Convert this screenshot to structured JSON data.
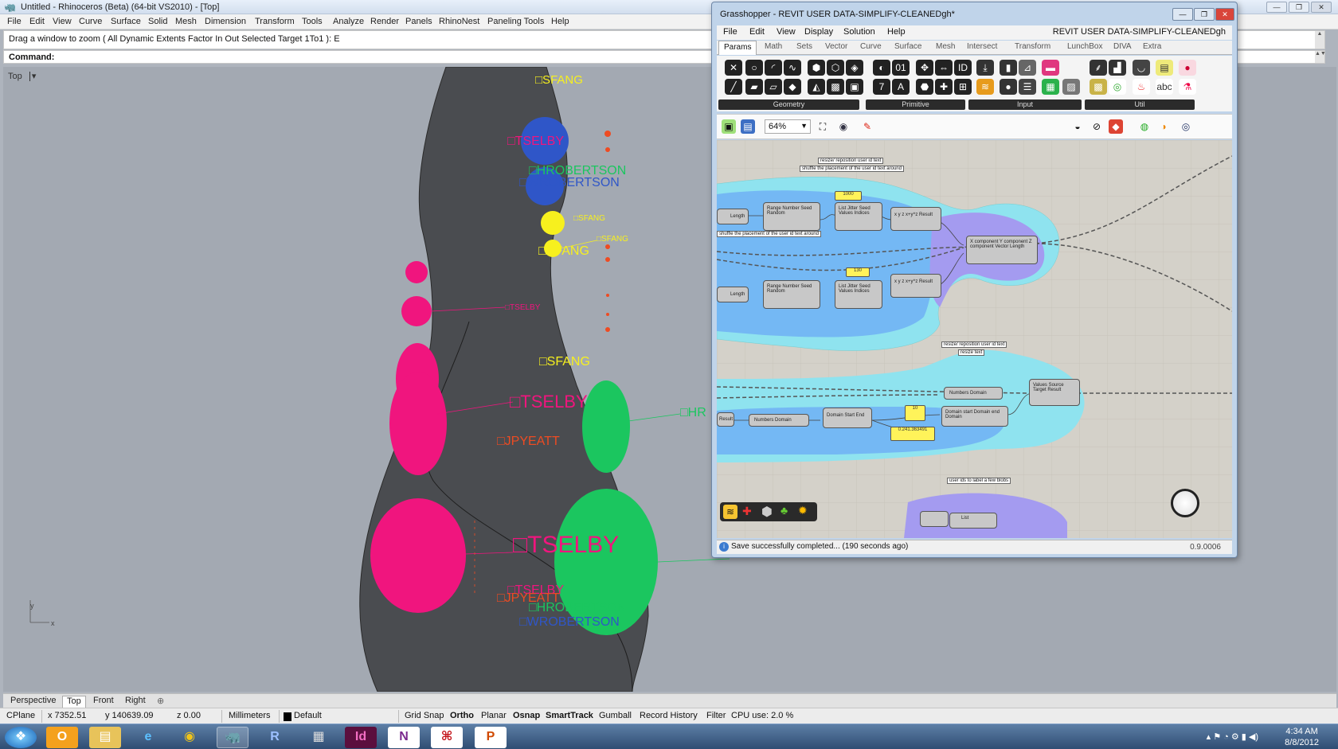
{
  "rhino": {
    "title": "Untitled - Rhinoceros (Beta) (64-bit VS2010) - [Top]",
    "menu": [
      "File",
      "Edit",
      "View",
      "Curve",
      "Surface",
      "Solid",
      "Mesh",
      "Dimension",
      "Transform",
      "Tools",
      "Analyze",
      "Render",
      "Panels",
      "RhinoNest",
      "Paneling Tools",
      "Help"
    ],
    "command_history": "Drag a window to zoom ( All  Dynamic  Extents  Factor  In  Out  Selected  Target  1To1 ): E",
    "command_label": "Command:",
    "viewport_label": "Top",
    "viewport_dropdown": "▾",
    "axis_y": "y",
    "axis_x": "x",
    "labels": {
      "sfang1": "□SFANG",
      "tselby1": "□TSELBY",
      "hrobertson1": "□HROBERTSON",
      "wrobertson1": "□WROBERTSON",
      "sfang2": "□SFANG",
      "sfang3": "□SFANG",
      "sfang4": "□SFANG",
      "tselby2": "□TSELBY",
      "sfang5": "□SFANG",
      "tselby3": "□TSELBY",
      "hr_partial": "□HR",
      "jpyeatt1": "□JPYEATT",
      "tselby4": "□TSELBY",
      "hrobertson_big": "□HROBERTSON",
      "tselby5": "□TSELBY",
      "jpyeatt2": "□JPYEATT",
      "hrobertson2": "□HROBERTSON",
      "wrobertson2": "□WROBERTSON"
    },
    "tabs": [
      "Perspective",
      "Top",
      "Front",
      "Right"
    ],
    "tab_add": "⊕",
    "status": {
      "cplane": "CPlane",
      "x": "x 7352.51",
      "y": "y 140639.09",
      "z": "z 0.00",
      "units": "Millimeters",
      "layer": "Default",
      "toggles": [
        "Grid Snap",
        "Ortho",
        "Planar",
        "Osnap",
        "SmartTrack",
        "Gumball",
        "Record History",
        "Filter"
      ],
      "bold_toggles": [
        "Ortho",
        "Osnap",
        "SmartTrack"
      ],
      "cpu": "CPU use: 2.0 %"
    }
  },
  "grasshopper": {
    "title": "Grasshopper - REVIT USER DATA-SIMPLIFY-CLEANEDgh*",
    "document": "REVIT USER DATA-SIMPLIFY-CLEANEDgh",
    "menu": [
      "File",
      "Edit",
      "View",
      "Display",
      "Solution",
      "Help"
    ],
    "tabs": [
      "Params",
      "Math",
      "Sets",
      "Vector",
      "Curve",
      "Surface",
      "Mesh",
      "Intersect",
      "Transform",
      "LunchBox",
      "DIVA",
      "Extra"
    ],
    "ribbon_groups": [
      "Geometry",
      "Primitive",
      "Input",
      "Util"
    ],
    "zoom": "64%",
    "status_message": "Save successfully completed... (190 seconds ago)",
    "version": "0.9.0006",
    "notes": {
      "n1": "resize/ reposition user id text",
      "n2": "shuffle the placement of the user id text around",
      "n3": "resize/ reposition user id text",
      "n4": "resize text",
      "n5": "user ids to label a few blobs",
      "n6": "shuffle the placement of the user id text around"
    },
    "values": {
      "v1": "1000",
      "v2": "130",
      "v3": "10",
      "v4": "0.241.363491"
    },
    "components": {
      "length": "Length",
      "range_random": "Range  Number  Seed   Random",
      "jitter": "List  Jitter  Seed   Values  Indices",
      "expr": "x  y  z   x+y^z   Result",
      "vector": "X component  Y component  Z component   Vector  Length",
      "remap": "Values  Source  Target   Result",
      "numbers_domain": "Numbers   Domain",
      "domain": "Domain   Start  End",
      "domain2": "Domain start  Domain end   Domain",
      "result": "Result",
      "list": "List"
    }
  },
  "taskbar": {
    "apps": [
      "start",
      "outlook",
      "explorer",
      "ie",
      "chrome",
      "rhino",
      "revit",
      "calc",
      "indesign",
      "onenote",
      "acrobat",
      "powerpoint"
    ],
    "clock_time": "4:34 AM",
    "clock_date": "8/8/2012"
  },
  "colors": {
    "pink": "#f0157e",
    "green": "#1bc65f",
    "blue": "#2f56c8",
    "yellow": "#f7f01e",
    "red": "#ee4b22",
    "blob": "#4a4c50",
    "cluster_light": "#8fe3ef",
    "cluster_mid": "#74b8f4",
    "cluster_purple": "#a49bf0"
  }
}
